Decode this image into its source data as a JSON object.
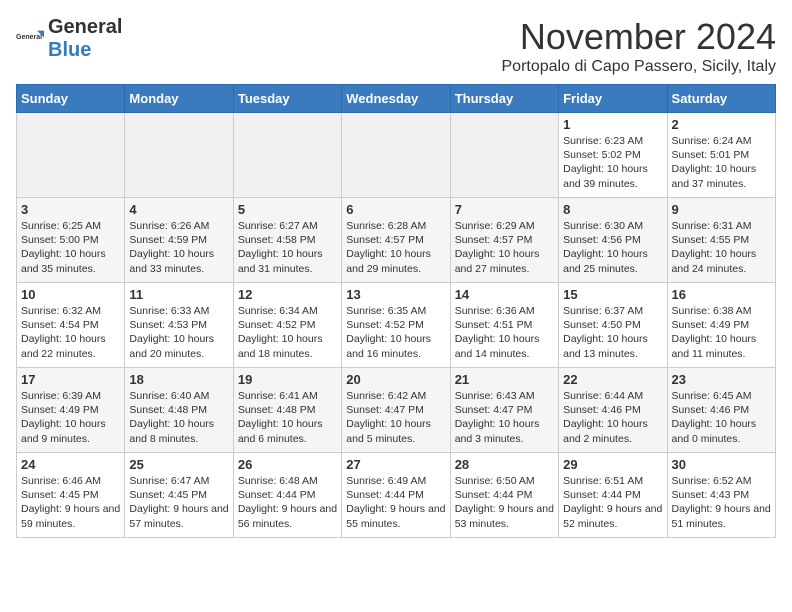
{
  "logo": {
    "text_general": "General",
    "text_blue": "Blue"
  },
  "title": "November 2024",
  "subtitle": "Portopalo di Capo Passero, Sicily, Italy",
  "days_of_week": [
    "Sunday",
    "Monday",
    "Tuesday",
    "Wednesday",
    "Thursday",
    "Friday",
    "Saturday"
  ],
  "weeks": [
    [
      {
        "day": "",
        "content": ""
      },
      {
        "day": "",
        "content": ""
      },
      {
        "day": "",
        "content": ""
      },
      {
        "day": "",
        "content": ""
      },
      {
        "day": "",
        "content": ""
      },
      {
        "day": "1",
        "content": "Sunrise: 6:23 AM\nSunset: 5:02 PM\nDaylight: 10 hours and 39 minutes."
      },
      {
        "day": "2",
        "content": "Sunrise: 6:24 AM\nSunset: 5:01 PM\nDaylight: 10 hours and 37 minutes."
      }
    ],
    [
      {
        "day": "3",
        "content": "Sunrise: 6:25 AM\nSunset: 5:00 PM\nDaylight: 10 hours and 35 minutes."
      },
      {
        "day": "4",
        "content": "Sunrise: 6:26 AM\nSunset: 4:59 PM\nDaylight: 10 hours and 33 minutes."
      },
      {
        "day": "5",
        "content": "Sunrise: 6:27 AM\nSunset: 4:58 PM\nDaylight: 10 hours and 31 minutes."
      },
      {
        "day": "6",
        "content": "Sunrise: 6:28 AM\nSunset: 4:57 PM\nDaylight: 10 hours and 29 minutes."
      },
      {
        "day": "7",
        "content": "Sunrise: 6:29 AM\nSunset: 4:57 PM\nDaylight: 10 hours and 27 minutes."
      },
      {
        "day": "8",
        "content": "Sunrise: 6:30 AM\nSunset: 4:56 PM\nDaylight: 10 hours and 25 minutes."
      },
      {
        "day": "9",
        "content": "Sunrise: 6:31 AM\nSunset: 4:55 PM\nDaylight: 10 hours and 24 minutes."
      }
    ],
    [
      {
        "day": "10",
        "content": "Sunrise: 6:32 AM\nSunset: 4:54 PM\nDaylight: 10 hours and 22 minutes."
      },
      {
        "day": "11",
        "content": "Sunrise: 6:33 AM\nSunset: 4:53 PM\nDaylight: 10 hours and 20 minutes."
      },
      {
        "day": "12",
        "content": "Sunrise: 6:34 AM\nSunset: 4:52 PM\nDaylight: 10 hours and 18 minutes."
      },
      {
        "day": "13",
        "content": "Sunrise: 6:35 AM\nSunset: 4:52 PM\nDaylight: 10 hours and 16 minutes."
      },
      {
        "day": "14",
        "content": "Sunrise: 6:36 AM\nSunset: 4:51 PM\nDaylight: 10 hours and 14 minutes."
      },
      {
        "day": "15",
        "content": "Sunrise: 6:37 AM\nSunset: 4:50 PM\nDaylight: 10 hours and 13 minutes."
      },
      {
        "day": "16",
        "content": "Sunrise: 6:38 AM\nSunset: 4:49 PM\nDaylight: 10 hours and 11 minutes."
      }
    ],
    [
      {
        "day": "17",
        "content": "Sunrise: 6:39 AM\nSunset: 4:49 PM\nDaylight: 10 hours and 9 minutes."
      },
      {
        "day": "18",
        "content": "Sunrise: 6:40 AM\nSunset: 4:48 PM\nDaylight: 10 hours and 8 minutes."
      },
      {
        "day": "19",
        "content": "Sunrise: 6:41 AM\nSunset: 4:48 PM\nDaylight: 10 hours and 6 minutes."
      },
      {
        "day": "20",
        "content": "Sunrise: 6:42 AM\nSunset: 4:47 PM\nDaylight: 10 hours and 5 minutes."
      },
      {
        "day": "21",
        "content": "Sunrise: 6:43 AM\nSunset: 4:47 PM\nDaylight: 10 hours and 3 minutes."
      },
      {
        "day": "22",
        "content": "Sunrise: 6:44 AM\nSunset: 4:46 PM\nDaylight: 10 hours and 2 minutes."
      },
      {
        "day": "23",
        "content": "Sunrise: 6:45 AM\nSunset: 4:46 PM\nDaylight: 10 hours and 0 minutes."
      }
    ],
    [
      {
        "day": "24",
        "content": "Sunrise: 6:46 AM\nSunset: 4:45 PM\nDaylight: 9 hours and 59 minutes."
      },
      {
        "day": "25",
        "content": "Sunrise: 6:47 AM\nSunset: 4:45 PM\nDaylight: 9 hours and 57 minutes."
      },
      {
        "day": "26",
        "content": "Sunrise: 6:48 AM\nSunset: 4:44 PM\nDaylight: 9 hours and 56 minutes."
      },
      {
        "day": "27",
        "content": "Sunrise: 6:49 AM\nSunset: 4:44 PM\nDaylight: 9 hours and 55 minutes."
      },
      {
        "day": "28",
        "content": "Sunrise: 6:50 AM\nSunset: 4:44 PM\nDaylight: 9 hours and 53 minutes."
      },
      {
        "day": "29",
        "content": "Sunrise: 6:51 AM\nSunset: 4:44 PM\nDaylight: 9 hours and 52 minutes."
      },
      {
        "day": "30",
        "content": "Sunrise: 6:52 AM\nSunset: 4:43 PM\nDaylight: 9 hours and 51 minutes."
      }
    ]
  ]
}
